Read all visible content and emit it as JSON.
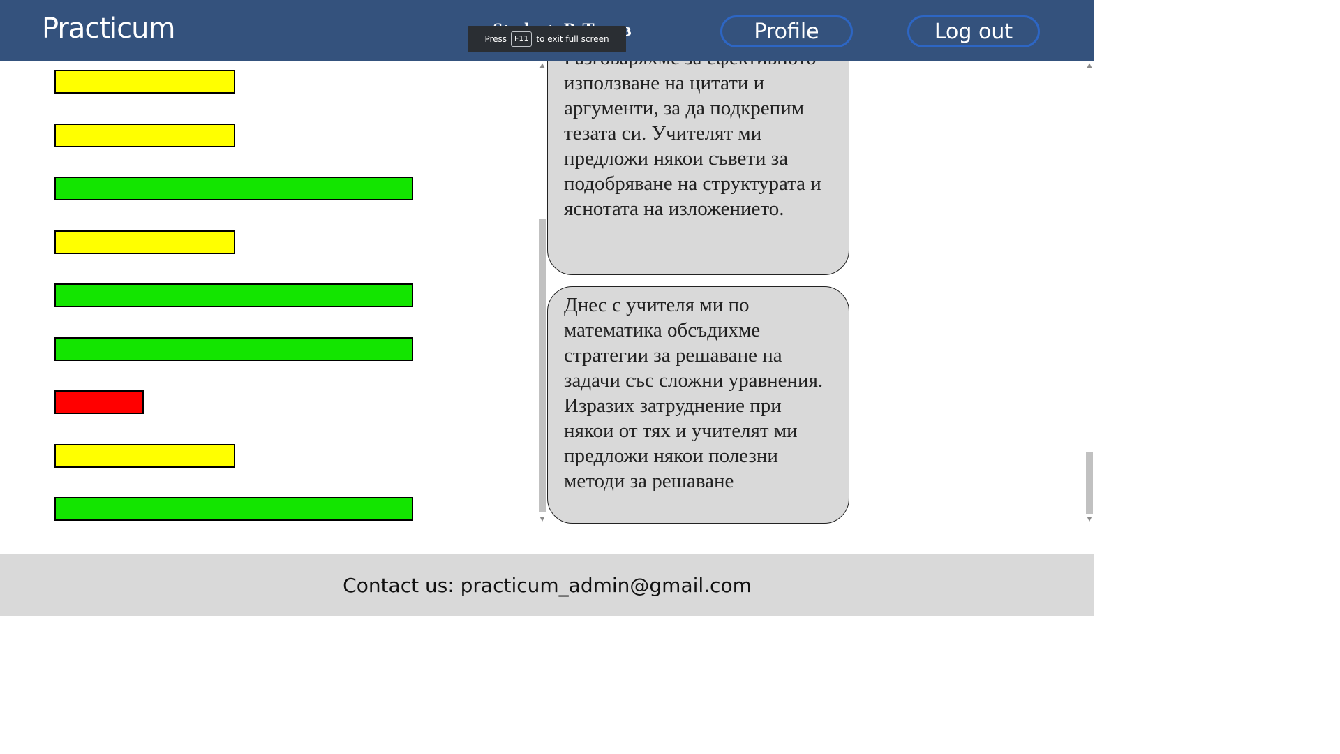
{
  "header": {
    "logo": "Practicum",
    "student_name": "Student: P. Титов",
    "profile_label": "Profile",
    "logout_label": "Log out",
    "background_color": "#34527d",
    "button_border_color": "#2d66c4"
  },
  "fullscreen_notice": {
    "prefix": "Press",
    "key": "F11",
    "suffix": "to exit full screen"
  },
  "bars": [
    {
      "color": "#ffff00",
      "level": "medium"
    },
    {
      "color": "#ffff00",
      "level": "medium"
    },
    {
      "color": "#13e500",
      "level": "high"
    },
    {
      "color": "#ffff00",
      "level": "medium"
    },
    {
      "color": "#13e500",
      "level": "high"
    },
    {
      "color": "#13e500",
      "level": "high"
    },
    {
      "color": "#ff0000",
      "level": "low"
    },
    {
      "color": "#ffff00",
      "level": "medium"
    },
    {
      "color": "#13e500",
      "level": "high"
    }
  ],
  "messages": [
    {
      "text": "творба, която изучаваме. Разговаряхме за ефективното използване на цитати и аргументи, за да подкрепим тезата си. Учителят ми предложи някои съвети за подобряване на структурата и яснотата на изложението."
    },
    {
      "text": "Днес с учителя ми по математика обсъдихме стратегии за решаване на задачи със сложни уравнения. Изразих затруднение при някои от тях и учителят ми предложи някои полезни методи за решаване"
    }
  ],
  "footer": {
    "contact": "Contact us: practicum_admin@gmail.com"
  }
}
